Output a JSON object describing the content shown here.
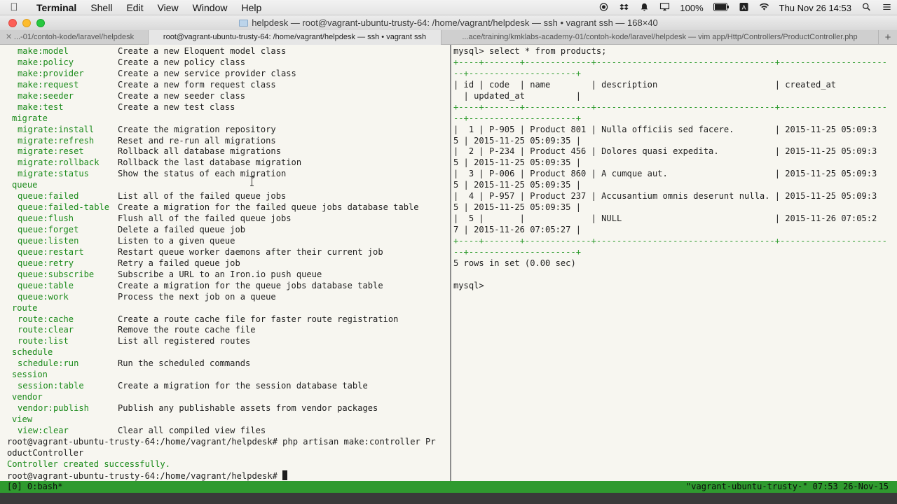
{
  "menubar": {
    "app": "Terminal",
    "items": [
      "Shell",
      "Edit",
      "View",
      "Window",
      "Help"
    ],
    "battery": "100%",
    "clock": "Thu Nov 26  14:53"
  },
  "window": {
    "title": "helpdesk — root@vagrant-ubuntu-trusty-64: /home/vagrant/helpdesk — ssh • vagrant ssh — 168×40"
  },
  "tabs": [
    "...-01/contoh-kode/laravel/helpdesk",
    "root@vagrant-ubuntu-trusty-64: /home/vagrant/helpdesk — ssh • vagrant ssh",
    "...ace/training/kmklabs-academy-01/contoh-kode/laravel/helpdesk — vim app/Http/Controllers/ProductController.php"
  ],
  "left_pane": {
    "rows": [
      {
        "t": "cmd",
        "cmd": "make:model",
        "desc": "Create a new Eloquent model class"
      },
      {
        "t": "cmd",
        "cmd": "make:policy",
        "desc": "Create a new policy class"
      },
      {
        "t": "cmd",
        "cmd": "make:provider",
        "desc": "Create a new service provider class"
      },
      {
        "t": "cmd",
        "cmd": "make:request",
        "desc": "Create a new form request class"
      },
      {
        "t": "cmd",
        "cmd": "make:seeder",
        "desc": "Create a new seeder class"
      },
      {
        "t": "cmd",
        "cmd": "make:test",
        "desc": "Create a new test class"
      },
      {
        "t": "group",
        "text": "migrate"
      },
      {
        "t": "cmd",
        "cmd": "migrate:install",
        "desc": "Create the migration repository"
      },
      {
        "t": "cmd",
        "cmd": "migrate:refresh",
        "desc": "Reset and re-run all migrations"
      },
      {
        "t": "cmd",
        "cmd": "migrate:reset",
        "desc": "Rollback all database migrations"
      },
      {
        "t": "cmd",
        "cmd": "migrate:rollback",
        "desc": "Rollback the last database migration"
      },
      {
        "t": "cmd",
        "cmd": "migrate:status",
        "desc": "Show the status of each migration"
      },
      {
        "t": "group",
        "text": "queue"
      },
      {
        "t": "cmd",
        "cmd": "queue:failed",
        "desc": "List all of the failed queue jobs"
      },
      {
        "t": "cmd",
        "cmd": "queue:failed-table",
        "desc": "Create a migration for the failed queue jobs database table"
      },
      {
        "t": "cmd",
        "cmd": "queue:flush",
        "desc": "Flush all of the failed queue jobs"
      },
      {
        "t": "cmd",
        "cmd": "queue:forget",
        "desc": "Delete a failed queue job"
      },
      {
        "t": "cmd",
        "cmd": "queue:listen",
        "desc": "Listen to a given queue"
      },
      {
        "t": "cmd",
        "cmd": "queue:restart",
        "desc": "Restart queue worker daemons after their current job"
      },
      {
        "t": "cmd",
        "cmd": "queue:retry",
        "desc": "Retry a failed queue job"
      },
      {
        "t": "cmd",
        "cmd": "queue:subscribe",
        "desc": "Subscribe a URL to an Iron.io push queue"
      },
      {
        "t": "cmd",
        "cmd": "queue:table",
        "desc": "Create a migration for the queue jobs database table"
      },
      {
        "t": "cmd",
        "cmd": "queue:work",
        "desc": "Process the next job on a queue"
      },
      {
        "t": "group",
        "text": "route"
      },
      {
        "t": "cmd",
        "cmd": "route:cache",
        "desc": "Create a route cache file for faster route registration"
      },
      {
        "t": "cmd",
        "cmd": "route:clear",
        "desc": "Remove the route cache file"
      },
      {
        "t": "cmd",
        "cmd": "route:list",
        "desc": "List all registered routes"
      },
      {
        "t": "group",
        "text": "schedule"
      },
      {
        "t": "cmd",
        "cmd": "schedule:run",
        "desc": "Run the scheduled commands"
      },
      {
        "t": "group",
        "text": "session"
      },
      {
        "t": "cmd",
        "cmd": "session:table",
        "desc": "Create a migration for the session database table"
      },
      {
        "t": "group",
        "text": "vendor"
      },
      {
        "t": "cmd",
        "cmd": "vendor:publish",
        "desc": "Publish any publishable assets from vendor packages"
      },
      {
        "t": "group",
        "text": "view"
      },
      {
        "t": "cmd",
        "cmd": "view:clear",
        "desc": "Clear all compiled view files"
      },
      {
        "t": "plain",
        "text": "root@vagrant-ubuntu-trusty-64:/home/vagrant/helpdesk# php artisan make:controller Pr"
      },
      {
        "t": "plain",
        "text": "oductController"
      },
      {
        "t": "ok",
        "text": "Controller created successfully."
      },
      {
        "t": "prompt",
        "text": "root@vagrant-ubuntu-trusty-64:/home/vagrant/helpdesk# "
      }
    ]
  },
  "right_pane": {
    "lines": [
      {
        "t": "plain",
        "text": "mysql> select * from products;"
      },
      {
        "t": "sep",
        "text": "+----+-------+-------------+-----------------------------------+---------------------"
      },
      {
        "t": "sep",
        "text": "--+---------------------+"
      },
      {
        "t": "plain",
        "text": "| id | code  | name        | description                       | created_at"
      },
      {
        "t": "plain",
        "text": "  | updated_at          |"
      },
      {
        "t": "sep",
        "text": "+----+-------+-------------+-----------------------------------+---------------------"
      },
      {
        "t": "sep",
        "text": "--+---------------------+"
      },
      {
        "t": "plain",
        "text": "|  1 | P-905 | Product 801 | Nulla officiis sed facere.        | 2015-11-25 05:09:3"
      },
      {
        "t": "plain",
        "text": "5 | 2015-11-25 05:09:35 |"
      },
      {
        "t": "plain",
        "text": "|  2 | P-234 | Product 456 | Dolores quasi expedita.           | 2015-11-25 05:09:3"
      },
      {
        "t": "plain",
        "text": "5 | 2015-11-25 05:09:35 |"
      },
      {
        "t": "plain",
        "text": "|  3 | P-006 | Product 860 | A cumque aut.                     | 2015-11-25 05:09:3"
      },
      {
        "t": "plain",
        "text": "5 | 2015-11-25 05:09:35 |"
      },
      {
        "t": "plain",
        "text": "|  4 | P-957 | Product 237 | Accusantium omnis deserunt nulla. | 2015-11-25 05:09:3"
      },
      {
        "t": "plain",
        "text": "5 | 2015-11-25 05:09:35 |"
      },
      {
        "t": "plain",
        "text": "|  5 |       |             | NULL                              | 2015-11-26 07:05:2"
      },
      {
        "t": "plain",
        "text": "7 | 2015-11-26 07:05:27 |"
      },
      {
        "t": "sep",
        "text": "+----+-------+-------------+-----------------------------------+---------------------"
      },
      {
        "t": "sep",
        "text": "--+---------------------+"
      },
      {
        "t": "plain",
        "text": "5 rows in set (0.00 sec)"
      },
      {
        "t": "plain",
        "text": ""
      },
      {
        "t": "plain",
        "text": "mysql> "
      }
    ]
  },
  "tmux": {
    "left": "[0] 0:bash*",
    "right": "\"vagrant-ubuntu-trusty-\" 07:53 26-Nov-15"
  }
}
